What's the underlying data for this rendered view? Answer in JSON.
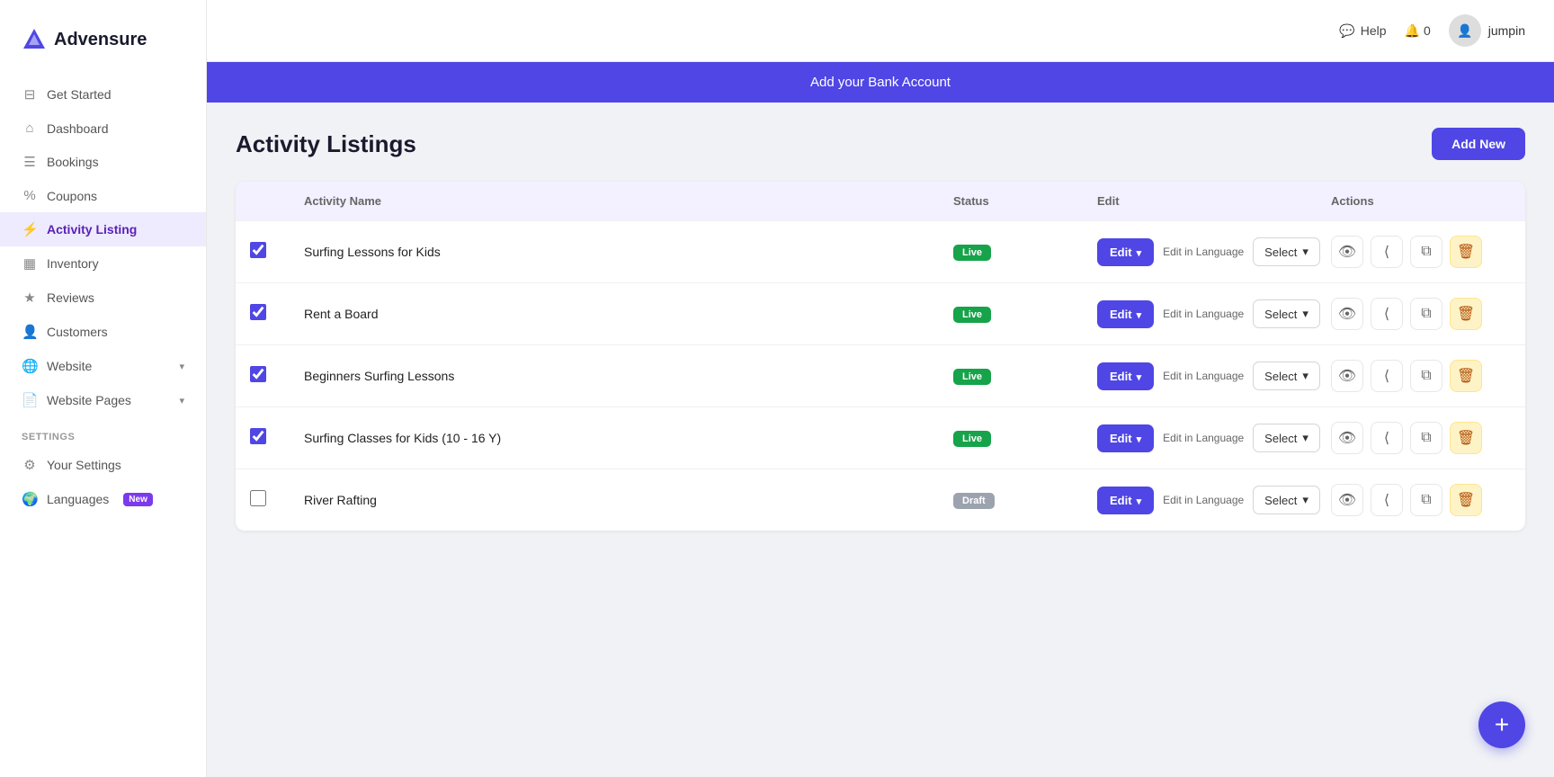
{
  "app": {
    "name": "Advensure"
  },
  "header": {
    "help_label": "Help",
    "bell_label": "0",
    "username": "jumpin"
  },
  "banner": {
    "text": "Add your Bank Account"
  },
  "sidebar": {
    "nav_items": [
      {
        "id": "get-started",
        "label": "Get Started",
        "icon": "⊟"
      },
      {
        "id": "dashboard",
        "label": "Dashboard",
        "icon": "⌂"
      },
      {
        "id": "bookings",
        "label": "Bookings",
        "icon": "☰"
      },
      {
        "id": "coupons",
        "label": "Coupons",
        "icon": "%"
      },
      {
        "id": "activity-listing",
        "label": "Activity Listing",
        "icon": "⚡",
        "active": true
      },
      {
        "id": "inventory",
        "label": "Inventory",
        "icon": "▦"
      },
      {
        "id": "reviews",
        "label": "Reviews",
        "icon": "★"
      },
      {
        "id": "customers",
        "label": "Customers",
        "icon": "👤"
      },
      {
        "id": "website",
        "label": "Website",
        "icon": "🌐",
        "has_arrow": true
      },
      {
        "id": "website-pages",
        "label": "Website Pages",
        "icon": "📄",
        "has_arrow": true
      }
    ],
    "settings_label": "Settings",
    "settings_items": [
      {
        "id": "your-settings",
        "label": "Your Settings",
        "icon": "⚙"
      },
      {
        "id": "languages",
        "label": "Languages",
        "icon": "🌍",
        "badge": "New"
      }
    ]
  },
  "page": {
    "title": "Activity Listings",
    "add_new_label": "Add New"
  },
  "table": {
    "columns": [
      "",
      "Activity Name",
      "Status",
      "Edit",
      "Actions"
    ],
    "rows": [
      {
        "id": 1,
        "checked": true,
        "name": "Surfing Lessons for Kids",
        "status": "Live",
        "status_type": "live",
        "edit_label": "Edit",
        "edit_lang_label": "Edit in Language",
        "select_label": "Select"
      },
      {
        "id": 2,
        "checked": true,
        "name": "Rent a Board",
        "status": "Live",
        "status_type": "live",
        "edit_label": "Edit",
        "edit_lang_label": "Edit in Language",
        "select_label": "Select"
      },
      {
        "id": 3,
        "checked": true,
        "name": "Beginners Surfing Lessons",
        "status": "Live",
        "status_type": "live",
        "edit_label": "Edit",
        "edit_lang_label": "Edit in Language",
        "select_label": "Select"
      },
      {
        "id": 4,
        "checked": true,
        "name": "Surfing Classes for Kids (10 - 16 Y)",
        "status": "Live",
        "status_type": "live",
        "edit_label": "Edit",
        "edit_lang_label": "Edit in Language",
        "select_label": "Select"
      },
      {
        "id": 5,
        "checked": false,
        "name": "River Rafting",
        "status": "Draft",
        "status_type": "draft",
        "edit_label": "Edit",
        "edit_lang_label": "Edit in Language",
        "select_label": "Select"
      }
    ]
  }
}
